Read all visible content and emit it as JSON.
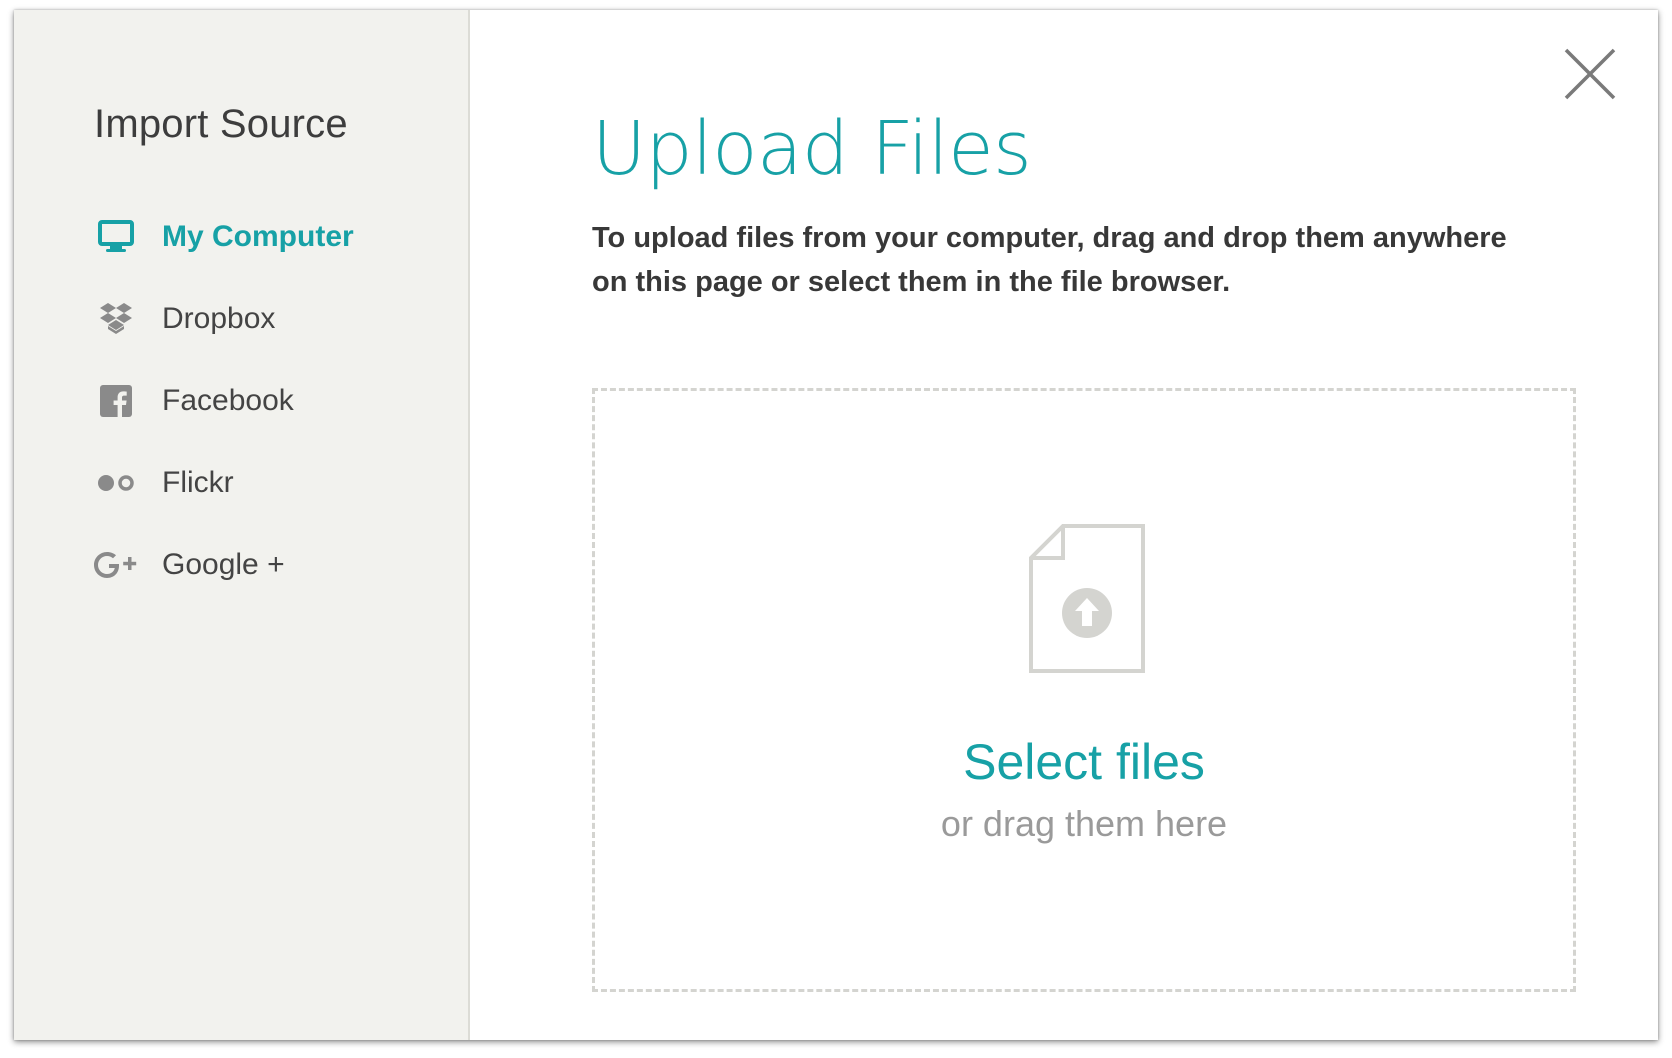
{
  "colors": {
    "accent": "#17a1a6",
    "sidebar_bg": "#f2f2ee",
    "icon_gray": "#8a8a8a",
    "dashed_border": "#d4d4d0"
  },
  "sidebar": {
    "title": "Import Source",
    "items": [
      {
        "label": "My Computer",
        "icon": "monitor-icon",
        "active": true
      },
      {
        "label": "Dropbox",
        "icon": "dropbox-icon",
        "active": false
      },
      {
        "label": "Facebook",
        "icon": "facebook-icon",
        "active": false
      },
      {
        "label": "Flickr",
        "icon": "flickr-icon",
        "active": false
      },
      {
        "label": "Google +",
        "icon": "google-plus-icon",
        "active": false
      }
    ]
  },
  "main": {
    "title": "Upload Files",
    "instructions": "To upload files from your computer, drag and drop them anywhere on this page or select them in the file browser.",
    "close_icon": "close-icon",
    "dropzone": {
      "file_icon": "file-upload-icon",
      "select_label": "Select files",
      "drag_hint": "or drag them here"
    }
  }
}
